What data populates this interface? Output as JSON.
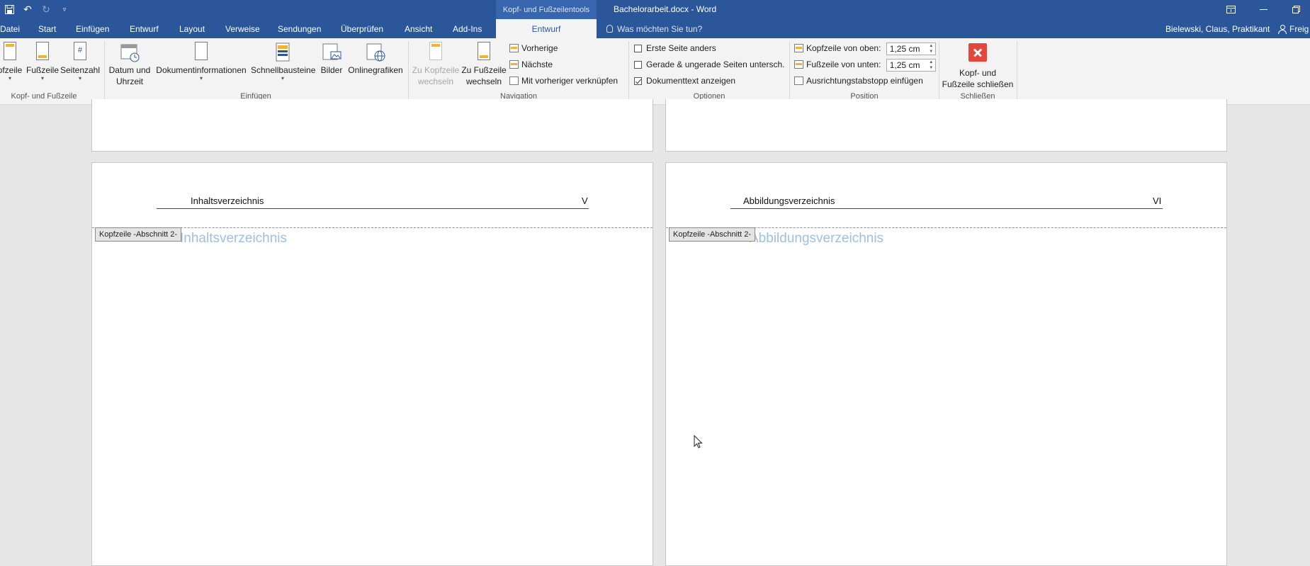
{
  "titlebar": {
    "context_group": "Kopf- und Fußzeilentools",
    "document_title": "Bachelorarbeit.docx - Word",
    "qat": {
      "save_icon": "save-icon",
      "undo_icon": "undo-icon",
      "redo_icon": "redo-icon",
      "customize_icon": "customize-qat-icon"
    },
    "window_controls": [
      "ribbon-display-icon",
      "minimize-icon",
      "restore-icon"
    ]
  },
  "tabs": [
    {
      "label": "Datei"
    },
    {
      "label": "Start"
    },
    {
      "label": "Einfügen"
    },
    {
      "label": "Entwurf"
    },
    {
      "label": "Layout"
    },
    {
      "label": "Verweise"
    },
    {
      "label": "Sendungen"
    },
    {
      "label": "Überprüfen"
    },
    {
      "label": "Ansicht"
    },
    {
      "label": "Add-Ins"
    },
    {
      "label": "Entwurf",
      "active": true
    }
  ],
  "tellme": {
    "placeholder": "Was möchten Sie tun?"
  },
  "user": {
    "name": "Bielewski, Claus, Praktikant",
    "share_label": "Freig"
  },
  "ribbon": {
    "groups": {
      "header_footer": {
        "label": "Kopf- und Fußzeile",
        "header": "pfzeile",
        "footer": "Fußzeile",
        "page_number": "Seitenzahl"
      },
      "insert": {
        "label": "Einfügen",
        "date_time_1": "Datum und",
        "date_time_2": "Uhrzeit",
        "doc_info": "Dokumentinformationen",
        "quick_parts": "Schnellbausteine",
        "pictures": "Bilder",
        "online_pictures": "Onlinegrafiken"
      },
      "navigation": {
        "label": "Navigation",
        "goto_header_1": "Zu Kopfzeile",
        "goto_header_2": "wechseln",
        "goto_footer_1": "Zu Fußzeile",
        "goto_footer_2": "wechseln",
        "previous": "Vorherige",
        "next": "Nächste",
        "link_previous": "Mit vorheriger verknüpfen"
      },
      "options": {
        "label": "Optionen",
        "different_first": "Erste Seite anders",
        "different_first_checked": false,
        "odd_even": "Gerade & ungerade Seiten untersch.",
        "odd_even_checked": false,
        "show_doc_text": "Dokumenttext anzeigen",
        "show_doc_text_checked": true
      },
      "position": {
        "label": "Position",
        "header_from_top": "Kopfzeile von oben:",
        "header_value": "1,25  cm",
        "footer_from_bottom": "Fußzeile von unten:",
        "footer_value": "1,25  cm",
        "insert_tab": "Ausrichtungstabstopp einfügen"
      },
      "close": {
        "label": "Schließen",
        "close_1": "Kopf- und",
        "close_2": "Fußzeile schließen"
      }
    }
  },
  "pages": {
    "left": {
      "header_title": "Inhaltsverzeichnis",
      "page_number": "V",
      "header_tag": "Kopfzeile -Abschnitt 2-",
      "ghost_heading": "Inhaltsverzeichnis"
    },
    "right": {
      "header_title": "Abbildungsverzeichnis",
      "page_number": "VI",
      "header_tag": "Kopfzeile -Abschnitt 2-",
      "ghost_heading": "Abbildungsverzeichnis"
    }
  },
  "colors": {
    "brand": "#2b579a",
    "ghost_text": "#9dc0e2",
    "close_red": "#e5463a"
  }
}
